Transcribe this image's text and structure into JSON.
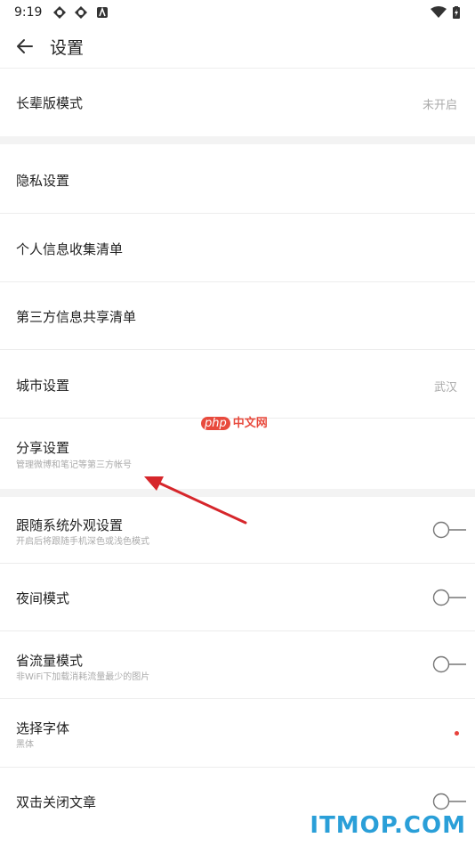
{
  "status": {
    "time": "9:19"
  },
  "header": {
    "title": "设置"
  },
  "settings": {
    "elderly_mode": {
      "label": "长辈版模式",
      "value": "未开启"
    },
    "privacy": {
      "label": "隐私设置"
    },
    "personal_info": {
      "label": "个人信息收集清单"
    },
    "third_party": {
      "label": "第三方信息共享清单"
    },
    "city": {
      "label": "城市设置",
      "value": "武汉"
    },
    "share": {
      "label": "分享设置",
      "desc": "管理微博和笔记等第三方帐号"
    },
    "follow_system": {
      "label": "跟随系统外观设置",
      "desc": "开启后将跟随手机深色或浅色模式",
      "enabled": false
    },
    "night_mode": {
      "label": "夜间模式",
      "enabled": false
    },
    "data_saver": {
      "label": "省流量模式",
      "desc": "非WiFi下加载消耗流量最少的图片",
      "enabled": false
    },
    "font": {
      "label": "选择字体",
      "desc": "黑体"
    },
    "double_tap_close": {
      "label": "双击关闭文章",
      "enabled": false
    }
  },
  "watermarks": {
    "php_a": "php",
    "php_b": "中文网",
    "itmop": "ITMOP.COM"
  },
  "colors": {
    "accent": "#e8413b",
    "watermark_blue": "#2a9fd8"
  }
}
